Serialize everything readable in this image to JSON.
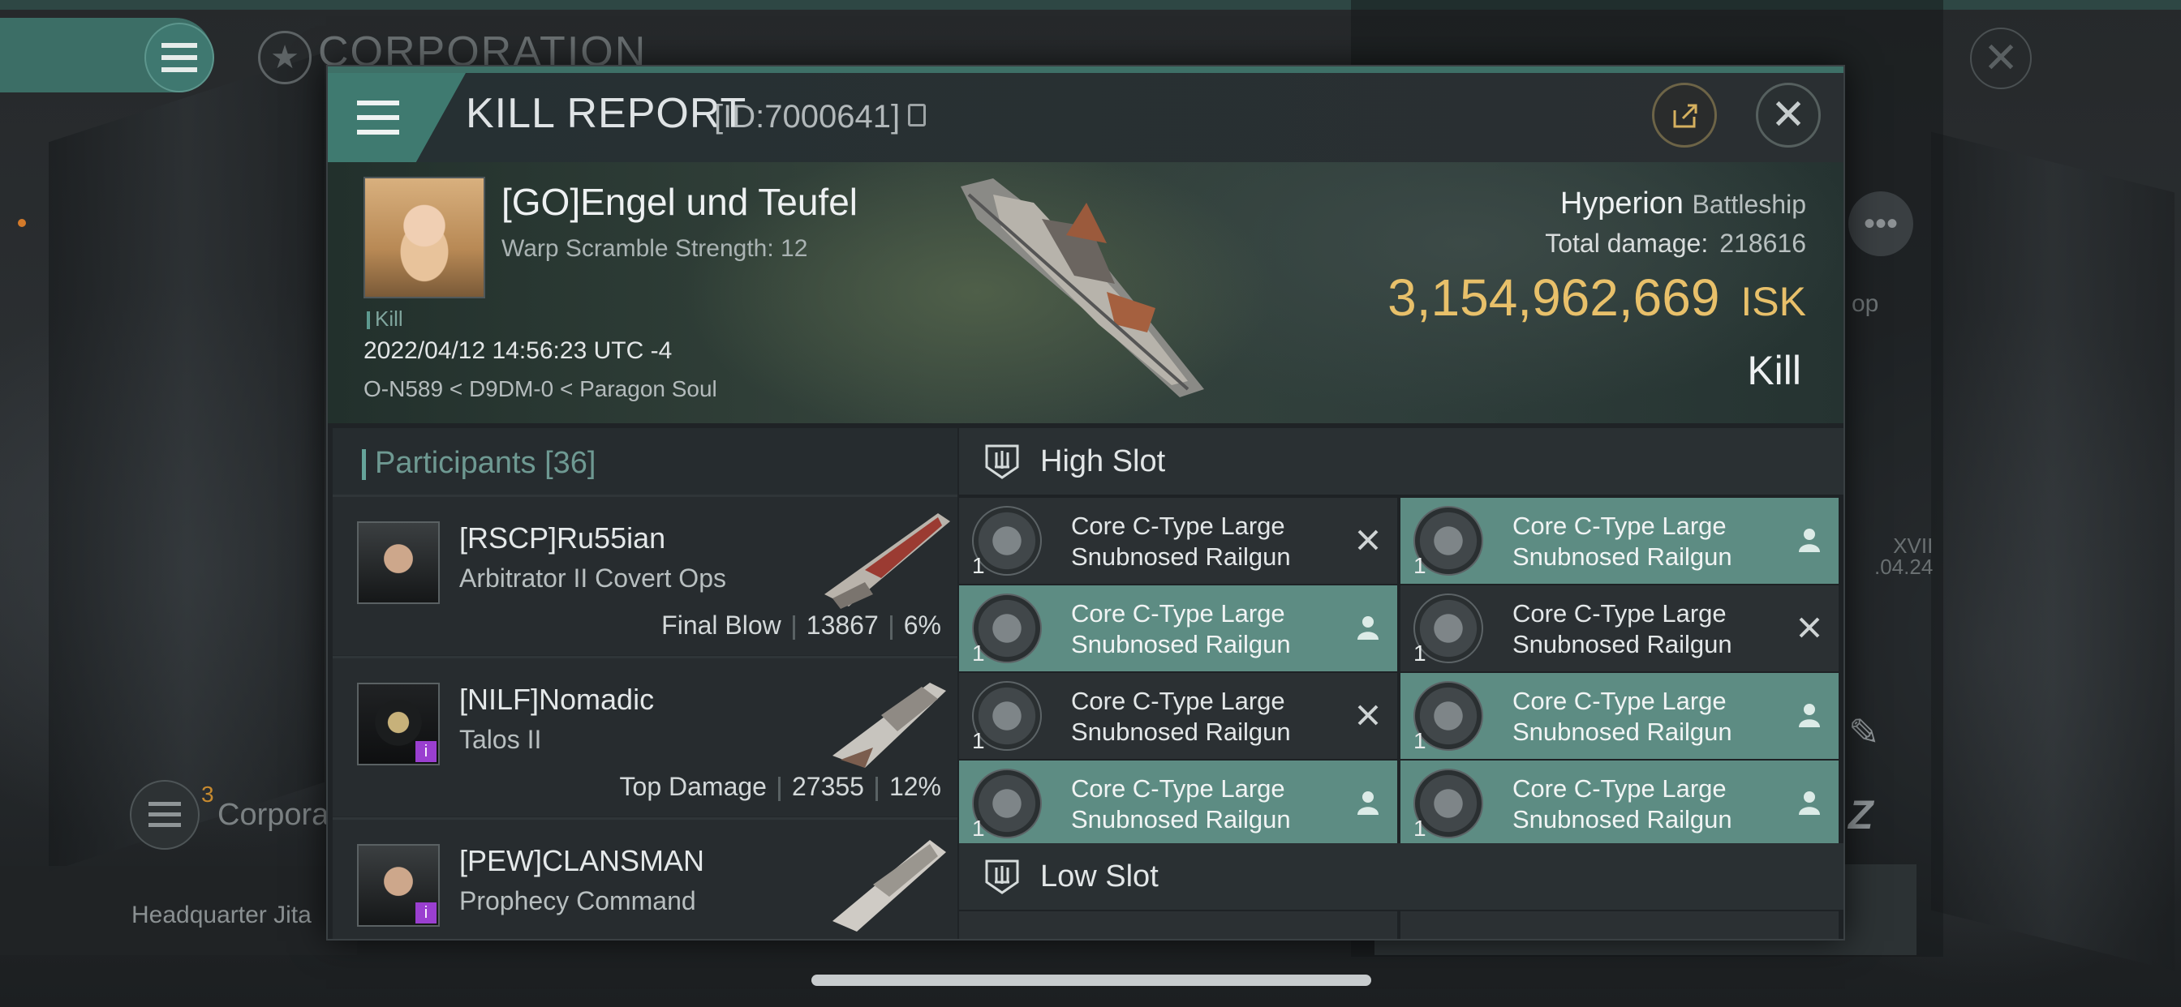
{
  "background": {
    "corp_title": "CORPORATION",
    "corp_section_label": "Corpora",
    "corp_badge": "3",
    "headquarter": "Headquarter Jita",
    "side_text": "op",
    "side_version": "XVII",
    "side_date": ".04.24"
  },
  "header": {
    "title": "KILL REPORT",
    "id": "[ID:7000641]"
  },
  "victim": {
    "name": "[GO]Engel und Teufel",
    "warp_scramble": "Warp Scramble Strength: 12",
    "tag": "Kill",
    "datetime": "2022/04/12 14:56:23 UTC -4",
    "location": "O-N589 < D9DM-0 < Paragon Soul",
    "ship": "Hyperion",
    "ship_class": "Battleship",
    "total_damage_label": "Total damage:",
    "total_damage": "218616",
    "isk_value": "3,154,962,669",
    "isk_unit": "ISK",
    "result": "Kill"
  },
  "participants": {
    "label": "Participants",
    "count": "[36]",
    "rows": [
      {
        "name": "[RSCP]Ru55ian",
        "ship": "Arbitrator II Covert Ops",
        "stat_label": "Final Blow",
        "damage": "13867",
        "percent": "6%"
      },
      {
        "name": "[NILF]Nomadic",
        "ship": "Talos II",
        "stat_label": "Top Damage",
        "damage": "27355",
        "percent": "12%"
      },
      {
        "name": "[PEW]CLANSMAN",
        "ship": "Prophecy Command",
        "stat_label": "",
        "damage": "",
        "percent": ""
      }
    ]
  },
  "slots": {
    "high_label": "High Slot",
    "low_label": "Low Slot",
    "high_modules": [
      {
        "line1": "Core C-Type Large",
        "line2": "Snubnosed Railgun",
        "qty": "1",
        "state": "destroyed"
      },
      {
        "line1": "Core C-Type Large",
        "line2": "Snubnosed Railgun",
        "qty": "1",
        "state": "dropped"
      },
      {
        "line1": "Core C-Type Large",
        "line2": "Snubnosed Railgun",
        "qty": "1",
        "state": "dropped"
      },
      {
        "line1": "Core C-Type Large",
        "line2": "Snubnosed Railgun",
        "qty": "1",
        "state": "destroyed"
      },
      {
        "line1": "Core C-Type Large",
        "line2": "Snubnosed Railgun",
        "qty": "1",
        "state": "destroyed"
      },
      {
        "line1": "Core C-Type Large",
        "line2": "Snubnosed Railgun",
        "qty": "1",
        "state": "dropped"
      },
      {
        "line1": "Core C-Type Large",
        "line2": "Snubnosed Railgun",
        "qty": "1",
        "state": "dropped"
      },
      {
        "line1": "Core C-Type Large",
        "line2": "Snubnosed Railgun",
        "qty": "1",
        "state": "dropped"
      }
    ]
  },
  "colors": {
    "accent_teal": "#3f7a70",
    "isk_gold": "#e8c06a",
    "dropped_bg": "#5d8c83",
    "destroyed_bg": "#2b3033"
  },
  "icons": {
    "destroyed": "close-x-icon",
    "dropped": "person-icon"
  }
}
